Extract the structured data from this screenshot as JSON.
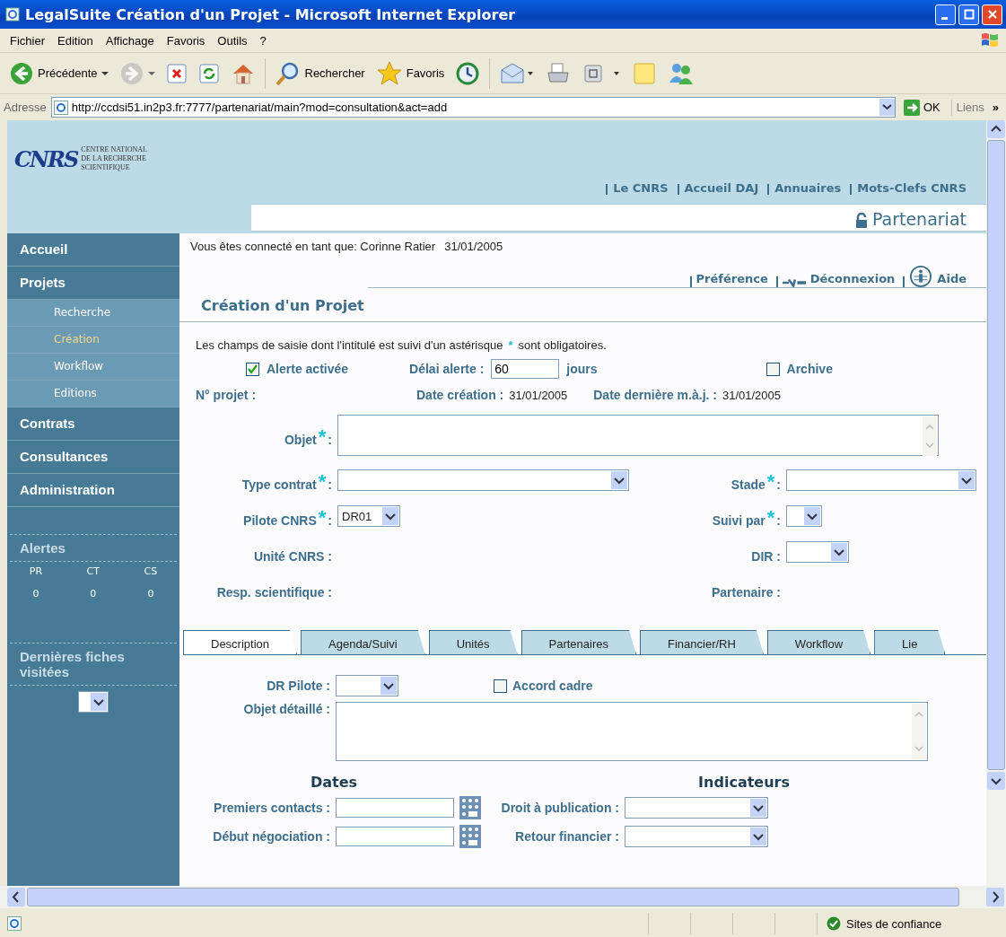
{
  "window": {
    "title": "LegalSuite Création d'un Projet - Microsoft Internet Explorer"
  },
  "menu": [
    "Fichier",
    "Edition",
    "Affichage",
    "Favoris",
    "Outils",
    "?"
  ],
  "toolbar": [
    {
      "kind": "back",
      "label": "Précédente",
      "disabled": false
    },
    {
      "kind": "forward",
      "disabled": true
    },
    {
      "kind": "stop",
      "disabled": false
    },
    {
      "kind": "refresh",
      "disabled": false
    },
    {
      "kind": "home",
      "disabled": false
    },
    {
      "kind": "search",
      "label": "Rechercher",
      "disabled": false
    },
    {
      "kind": "favorites",
      "label": "Favoris",
      "disabled": false
    },
    {
      "kind": "history",
      "disabled": false
    },
    {
      "kind": "mail",
      "disabled": false
    },
    {
      "kind": "print",
      "disabled": false
    },
    {
      "kind": "edit",
      "disabled": false
    },
    {
      "kind": "note",
      "disabled": false
    },
    {
      "kind": "messenger",
      "disabled": false
    }
  ],
  "address": {
    "label": "Adresse",
    "value": "http://ccdsi51.in2p3.fr:7777/partenariat/main?mod=consultation&act=add",
    "go": "OK",
    "links": "Liens",
    "more": "»"
  },
  "site": {
    "logo": "CNRS",
    "org_lines": [
      "CENTRE NATIONAL",
      "DE LA RECHERCHE",
      "SCIENTIFIQUE"
    ],
    "top_links": [
      "Le CNRS",
      "Accueil DAJ",
      "Annuaires",
      "Mots-Clefs CNRS"
    ],
    "app_title": "Partenariat"
  },
  "sidebar": {
    "items": [
      {
        "label": "Accueil"
      },
      {
        "label": "Projets",
        "children": [
          {
            "label": "Recherche",
            "selected": false
          },
          {
            "label": "Création",
            "selected": true
          },
          {
            "label": "Workflow",
            "selected": false
          },
          {
            "label": "Editions",
            "selected": false
          }
        ]
      },
      {
        "label": "Contrats"
      },
      {
        "label": "Consultances"
      },
      {
        "label": "Administration"
      }
    ],
    "alerts": {
      "title": "Alertes",
      "columns": [
        {
          "label": "PR",
          "count": "0"
        },
        {
          "label": "CT",
          "count": "0"
        },
        {
          "label": "CS",
          "count": "0"
        }
      ]
    },
    "recent": {
      "title": "Dernières fiches visitées"
    }
  },
  "user_bar": {
    "text": "Vous êtes connecté en tant que: Corinne Ratier",
    "date": "31/01/2005",
    "links": [
      {
        "kind": "pref",
        "label": "Préférence"
      },
      {
        "kind": "logout",
        "label": "Déconnexion"
      },
      {
        "kind": "help",
        "label": "Aide"
      }
    ]
  },
  "page_title": "Création d'un Projet",
  "form": {
    "note_before": "Les champs de saisie dont l'intitulé est suivi d'un astérisque",
    "note_after": "sont obligatoires.",
    "required_mark": "*",
    "label_suffix": ":",
    "alert": {
      "label": "Alerte activée",
      "checked": true
    },
    "delay": {
      "label": "Délai alerte :",
      "value": "60",
      "unit": "jours"
    },
    "archive": {
      "label": "Archive",
      "checked": false
    },
    "project_no": "N° projet :",
    "created": {
      "label": "Date création :",
      "value": "31/01/2005"
    },
    "updated": {
      "label": "Date dernière m.à.j. :",
      "value": "31/01/2005"
    },
    "object": {
      "label": "Objet",
      "required": true
    },
    "rows": [
      {
        "left": {
          "label": "Type contrat",
          "required": true,
          "kind": "combo"
        },
        "right": {
          "label": "Stade",
          "required": true,
          "kind": "combo"
        }
      },
      {
        "left": {
          "label": "Pilote CNRS",
          "required": true,
          "kind": "select",
          "value": "DR01"
        },
        "right": {
          "label": "Suivi par",
          "required": true,
          "kind": "mini"
        }
      },
      {
        "left": {
          "label": "Unité CNRS",
          "required": false,
          "kind": "label"
        },
        "right": {
          "label": "DIR",
          "required": false,
          "kind": "select"
        }
      },
      {
        "left": {
          "label": "Resp. scientifique",
          "required": false,
          "kind": "label"
        },
        "right": {
          "label": "Partenaire",
          "required": false,
          "kind": "label"
        }
      }
    ]
  },
  "tabs": [
    {
      "label": "Description",
      "selected": true
    },
    {
      "label": "Agenda/Suivi",
      "selected": false
    },
    {
      "label": "Unités",
      "selected": false
    },
    {
      "label": "Partenaires",
      "selected": false
    },
    {
      "label": "Financier/RH",
      "selected": false
    },
    {
      "label": "Workflow",
      "selected": false
    },
    {
      "label": "Lie",
      "selected": false
    }
  ],
  "description": {
    "dr_pilote": {
      "label": "DR Pilote :"
    },
    "accord": {
      "label": "Accord cadre",
      "checked": false
    },
    "detail": {
      "label": "Objet détaillé :"
    },
    "dates": {
      "title": "Dates",
      "rows": [
        "Premiers contacts :",
        "Début négociation :"
      ]
    },
    "indicators": {
      "title": "Indicateurs",
      "rows": [
        "Droit à publication :",
        "Retour financier :"
      ]
    }
  },
  "status_bar": {
    "zone": "Sites de confiance"
  }
}
